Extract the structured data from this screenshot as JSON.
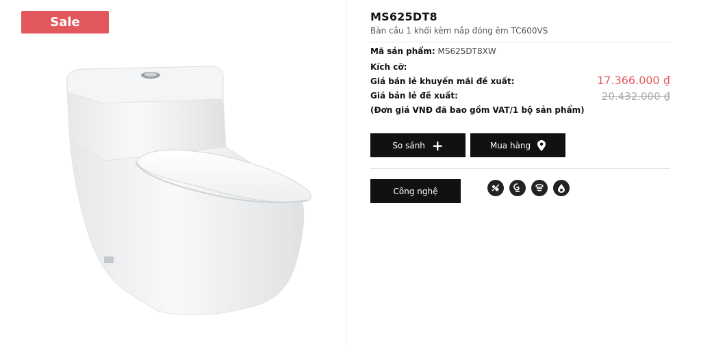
{
  "badge": {
    "sale": "Sale"
  },
  "product": {
    "title": "MS625DT8",
    "subtitle": "Bàn cầu 1 khối kèm nắp đóng êm TC600VS",
    "sku_label": "Mã sản phẩm:",
    "sku_value": "MS625DT8XW",
    "size_label": "Kích cỡ:",
    "promo_label": "Giá bán lẻ khuyến mãi đề xuất:",
    "promo_price": "17.366.000 ₫",
    "retail_label": "Giá bản lẻ đề xuất:",
    "retail_price": "20.432.000 ₫",
    "price_note": "(Đơn giá VNĐ đã bao gồm VAT/1 bộ sản phẩm)"
  },
  "actions": {
    "compare_label": "So sánh",
    "buy_label": "Mua hàng",
    "tech_label": "Công nghệ"
  },
  "icons": {
    "compare": "plus-icon",
    "buy": "map-pin-icon",
    "tech": [
      "cefiontect-icon",
      "tornado-flush-icon",
      "rimless-icon",
      "water-drop-icon"
    ]
  },
  "colors": {
    "accent": "#e2575b",
    "button": "#111111"
  }
}
